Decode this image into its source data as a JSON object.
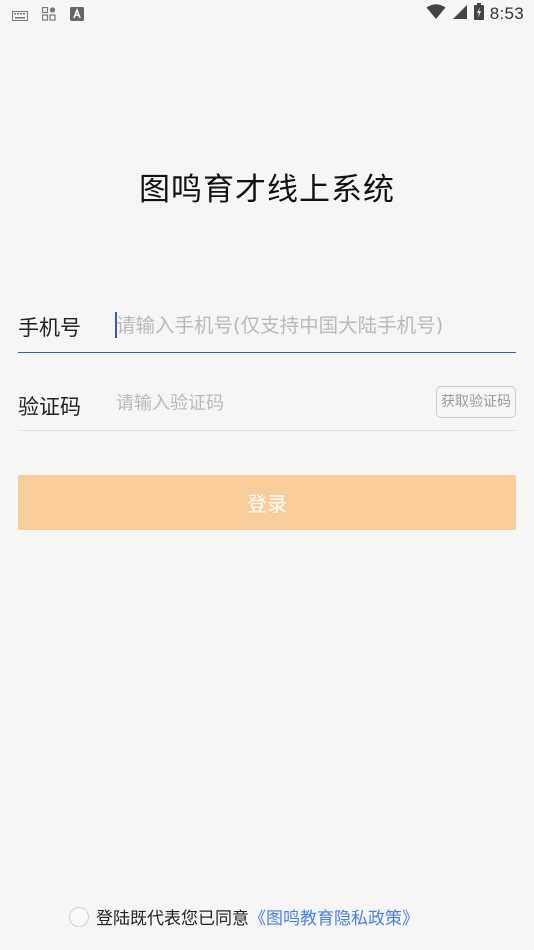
{
  "status_bar": {
    "time": "8:53",
    "left_icons": [
      "keyboard-icon",
      "apps-icon",
      "a-letter-icon"
    ],
    "right_icons": [
      "wifi-icon",
      "cellular-signal-icon",
      "battery-icon"
    ]
  },
  "app": {
    "title": "图鸣育才线上系统"
  },
  "phone_field": {
    "label": "手机号",
    "value": "",
    "placeholder": "请输入手机号(仅支持中国大陆手机号)"
  },
  "code_field": {
    "label": "验证码",
    "value": "",
    "placeholder": "请输入验证码",
    "get_code_label": "获取验证码"
  },
  "login_button": {
    "label": "登录"
  },
  "agreement": {
    "checked": false,
    "text": "登陆既代表您已同意",
    "link_text": "《图鸣教育隐私政策》"
  },
  "colors": {
    "background": "#f6f6f6",
    "accent": "#3b57c7",
    "login_button_bg": "#f8cd9a",
    "link": "#4a7fe0"
  }
}
